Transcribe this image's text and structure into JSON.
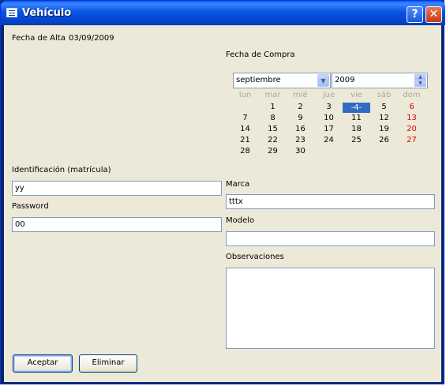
{
  "window": {
    "title": "Vehículo"
  },
  "form": {
    "fecha_alta_label": "Fecha de Alta",
    "fecha_alta_value": "03/09/2009",
    "identificacion_label": "Identificación (matrícula)",
    "identificacion_value": "yy",
    "password_label": "Password",
    "password_value": "00",
    "marca_label": "Marca",
    "marca_value": "tttx",
    "modelo_label": "Modelo",
    "modelo_value": "",
    "observaciones_label": "Observaciones",
    "observaciones_value": ""
  },
  "calendar": {
    "label": "Fecha de Compra",
    "month": "septiembre",
    "year": "2009",
    "weekdays": [
      "lun",
      "mar",
      "mié",
      "jue",
      "vie",
      "sáb",
      "dom"
    ],
    "weeks": [
      [
        "",
        "1",
        "2",
        "3",
        "-4-",
        "5",
        "6"
      ],
      [
        "7",
        "8",
        "9",
        "10",
        "11",
        "12",
        "13"
      ],
      [
        "14",
        "15",
        "16",
        "17",
        "18",
        "19",
        "20"
      ],
      [
        "21",
        "22",
        "23",
        "24",
        "25",
        "26",
        "27"
      ],
      [
        "28",
        "29",
        "30",
        "",
        "",
        "",
        ""
      ]
    ],
    "selected_day": "-4-"
  },
  "buttons": {
    "aceptar": "Aceptar",
    "eliminar": "Eliminar"
  },
  "colors": {
    "selected": "#316ac5",
    "weekend": "#e00000",
    "weekday_header": "#aca899"
  }
}
